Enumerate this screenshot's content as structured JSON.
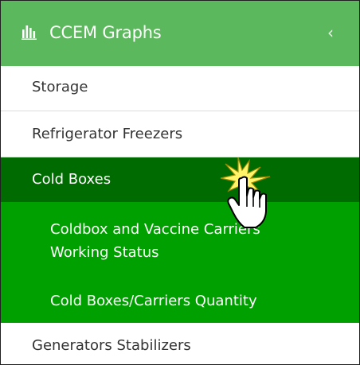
{
  "sidebar": {
    "header": {
      "icon": "bar-chart-icon",
      "title": "CCEM Graphs",
      "collapse_icon": "chevron-left-icon",
      "collapse_glyph": "‹",
      "color": "#5cb85c"
    },
    "items": [
      {
        "label": "Storage"
      },
      {
        "label": "Refrigerator Freezers"
      },
      {
        "label": "Cold Boxes",
        "active": true,
        "color": "#006b00"
      },
      {
        "label": "Generators Stabilizers"
      }
    ],
    "subitems": [
      {
        "label_line1": "Coldbox and Vaccine Carriers",
        "label_line2": "Working Status"
      },
      {
        "label": "Cold Boxes/Carriers Quantity"
      }
    ],
    "submenu_color": "#00a000"
  },
  "cursor": {
    "icon": "hand-pointer-cursor-icon",
    "highlight_icon": "click-burst-icon"
  }
}
